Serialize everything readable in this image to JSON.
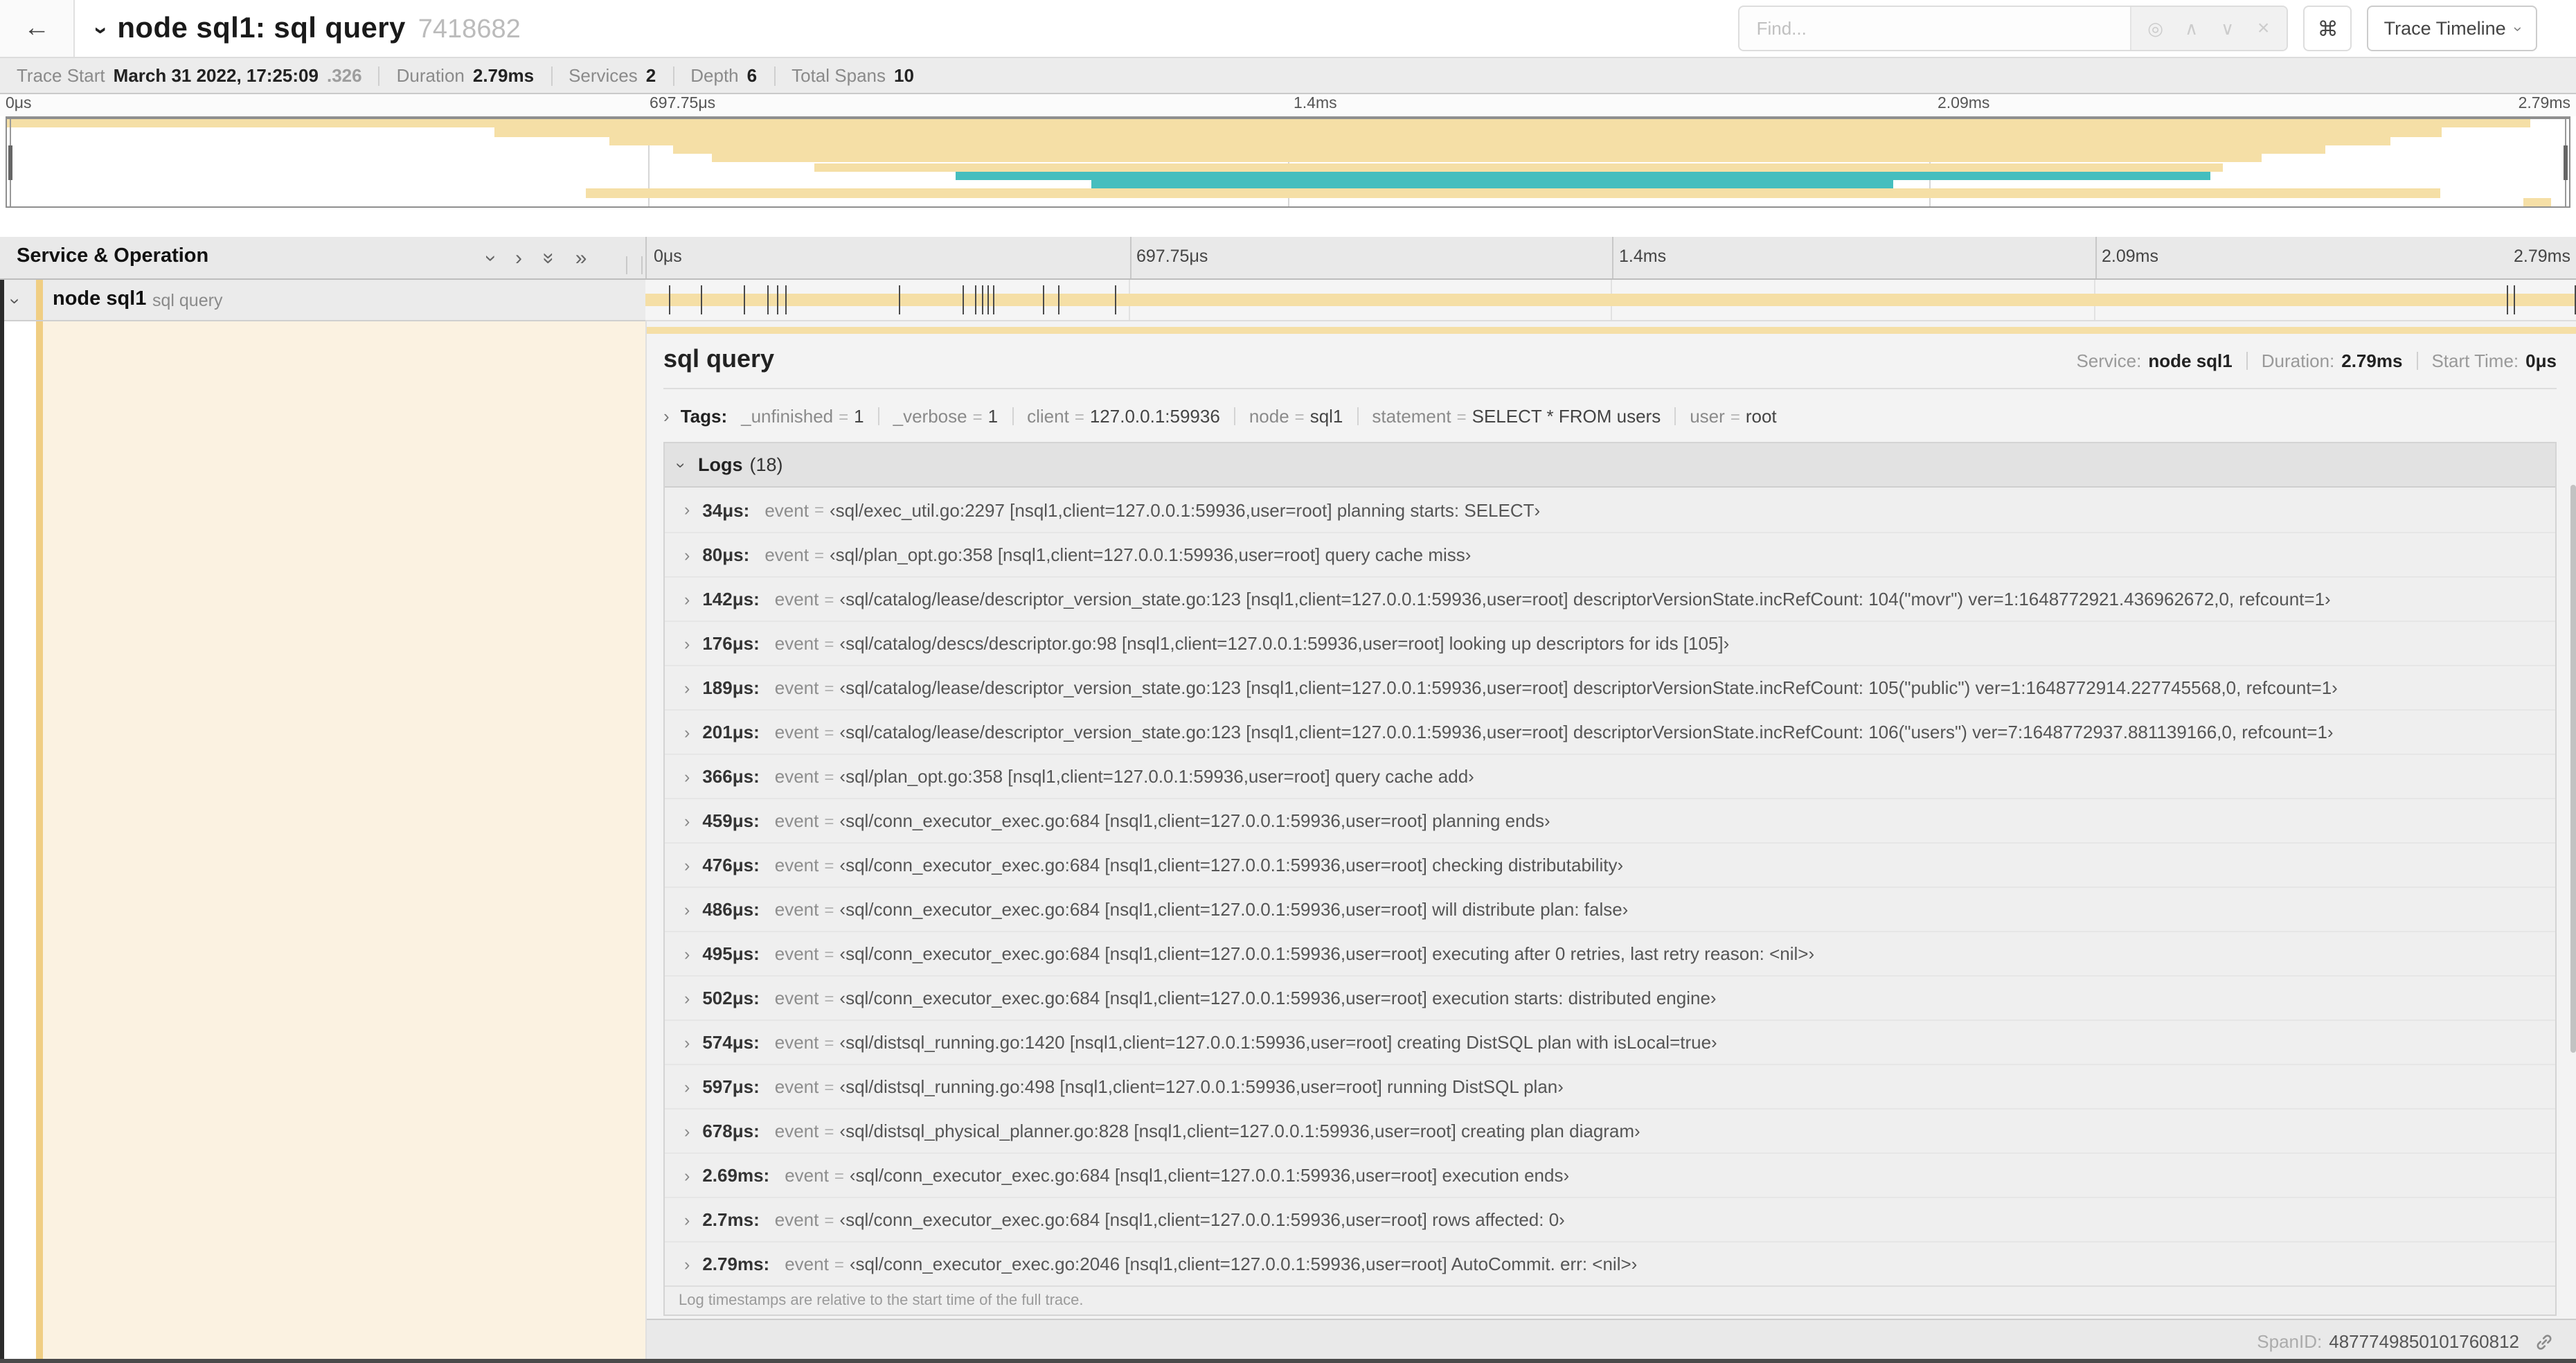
{
  "header": {
    "back_icon": "←",
    "collapse_caret_icon": "›",
    "title": "node sql1: sql query",
    "trace_id": "7418682",
    "find": {
      "placeholder": "Find...",
      "locate_icon": "◎",
      "prev_icon": "∧",
      "next_icon": "∨",
      "clear_icon": "×"
    },
    "shortcut_button_label": "⌘",
    "view_selector_label": "Trace Timeline"
  },
  "trace_bar": {
    "items": [
      {
        "label": "Trace Start",
        "value": "March 31 2022, 17:25:09",
        "muted_suffix": ".326"
      },
      {
        "label": "Duration",
        "value": "2.79ms"
      },
      {
        "label": "Services",
        "value": "2"
      },
      {
        "label": "Depth",
        "value": "6"
      },
      {
        "label": "Total Spans",
        "value": "10"
      }
    ]
  },
  "timeline": {
    "ticks": [
      "0μs",
      "697.75μs",
      "1.4ms",
      "2.09ms",
      "2.79ms"
    ],
    "service_operation_label": "Service & Operation",
    "minimap_spans": [
      {
        "start": 0,
        "end": 98.5,
        "color": "#F5DFA6"
      },
      {
        "start": 19,
        "end": 95,
        "color": "#F5DFA6"
      },
      {
        "start": 23.5,
        "end": 93,
        "color": "#F5DFA6"
      },
      {
        "start": 26,
        "end": 90.5,
        "color": "#F5DFA6"
      },
      {
        "start": 27.5,
        "end": 88,
        "color": "#F5DFA6"
      },
      {
        "start": 31.5,
        "end": 86.5,
        "color": "#F5DFA6"
      },
      {
        "start": 37,
        "end": 86,
        "color": "#45BEBE"
      },
      {
        "start": 42.3,
        "end": 73.6,
        "color": "#45BEBE"
      },
      {
        "start": 22.6,
        "end": 95,
        "color": "#F5DFA6"
      },
      {
        "start": 98.2,
        "end": 99.3,
        "color": "#F5DFA6"
      }
    ],
    "row": {
      "service": "node sql1",
      "operation": "sql query",
      "log_marker_fractions": [
        0.0122,
        0.0287,
        0.0509,
        0.0631,
        0.0678,
        0.0721,
        0.1312,
        0.1645,
        0.1706,
        0.1742,
        0.1774,
        0.18,
        0.2057,
        0.214,
        0.243,
        0.964,
        0.968,
        0.999
      ]
    }
  },
  "detail": {
    "title": "sql query",
    "overview": [
      {
        "label": "Service:",
        "value": "node sql1"
      },
      {
        "label": "Duration:",
        "value": "2.79ms"
      },
      {
        "label": "Start Time:",
        "value": "0μs"
      }
    ],
    "tags": {
      "label": "Tags:",
      "items": [
        {
          "key": "_unfinished",
          "value": "1"
        },
        {
          "key": "_verbose",
          "value": "1"
        },
        {
          "key": "client",
          "value": "127.0.0.1:59936"
        },
        {
          "key": "node",
          "value": "sql1"
        },
        {
          "key": "statement",
          "value": "SELECT * FROM users"
        },
        {
          "key": "user",
          "value": "root"
        }
      ]
    },
    "logs": {
      "label": "Logs",
      "count": "(18)",
      "field_name": "event",
      "entries": [
        {
          "time": "34μs:",
          "value": "‹sql/exec_util.go:2297 [nsql1,client=127.0.0.1:59936,user=root] planning starts: SELECT›"
        },
        {
          "time": "80μs:",
          "value": "‹sql/plan_opt.go:358 [nsql1,client=127.0.0.1:59936,user=root] query cache miss›"
        },
        {
          "time": "142μs:",
          "value": "‹sql/catalog/lease/descriptor_version_state.go:123 [nsql1,client=127.0.0.1:59936,user=root] descriptorVersionState.incRefCount: 104(\"movr\") ver=1:1648772921.436962672,0, refcount=1›"
        },
        {
          "time": "176μs:",
          "value": "‹sql/catalog/descs/descriptor.go:98 [nsql1,client=127.0.0.1:59936,user=root] looking up descriptors for ids [105]›"
        },
        {
          "time": "189μs:",
          "value": "‹sql/catalog/lease/descriptor_version_state.go:123 [nsql1,client=127.0.0.1:59936,user=root] descriptorVersionState.incRefCount: 105(\"public\") ver=1:1648772914.227745568,0, refcount=1›"
        },
        {
          "time": "201μs:",
          "value": "‹sql/catalog/lease/descriptor_version_state.go:123 [nsql1,client=127.0.0.1:59936,user=root] descriptorVersionState.incRefCount: 106(\"users\") ver=7:1648772937.881139166,0, refcount=1›"
        },
        {
          "time": "366μs:",
          "value": "‹sql/plan_opt.go:358 [nsql1,client=127.0.0.1:59936,user=root] query cache add›"
        },
        {
          "time": "459μs:",
          "value": "‹sql/conn_executor_exec.go:684 [nsql1,client=127.0.0.1:59936,user=root] planning ends›"
        },
        {
          "time": "476μs:",
          "value": "‹sql/conn_executor_exec.go:684 [nsql1,client=127.0.0.1:59936,user=root] checking distributability›"
        },
        {
          "time": "486μs:",
          "value": "‹sql/conn_executor_exec.go:684 [nsql1,client=127.0.0.1:59936,user=root] will distribute plan: false›"
        },
        {
          "time": "495μs:",
          "value": "‹sql/conn_executor_exec.go:684 [nsql1,client=127.0.0.1:59936,user=root] executing after 0 retries, last retry reason: <nil>›"
        },
        {
          "time": "502μs:",
          "value": "‹sql/conn_executor_exec.go:684 [nsql1,client=127.0.0.1:59936,user=root] execution starts: distributed engine›"
        },
        {
          "time": "574μs:",
          "value": "‹sql/distsql_running.go:1420 [nsql1,client=127.0.0.1:59936,user=root] creating DistSQL plan with isLocal=true›"
        },
        {
          "time": "597μs:",
          "value": "‹sql/distsql_running.go:498 [nsql1,client=127.0.0.1:59936,user=root] running DistSQL plan›"
        },
        {
          "time": "678μs:",
          "value": "‹sql/distsql_physical_planner.go:828 [nsql1,client=127.0.0.1:59936,user=root] creating plan diagram›"
        },
        {
          "time": "2.69ms:",
          "value": "‹sql/conn_executor_exec.go:684 [nsql1,client=127.0.0.1:59936,user=root] execution ends›"
        },
        {
          "time": "2.7ms:",
          "value": "‹sql/conn_executor_exec.go:684 [nsql1,client=127.0.0.1:59936,user=root] rows affected: 0›"
        },
        {
          "time": "2.79ms:",
          "value": "‹sql/conn_executor_exec.go:2046 [nsql1,client=127.0.0.1:59936,user=root] AutoCommit. err: <nil>›"
        }
      ],
      "note": "Log timestamps are relative to the start time of the full trace."
    },
    "footer": {
      "label": "SpanID:",
      "value": "4877749850101760812"
    }
  },
  "colors": {
    "span_tan": "#F5DFA6",
    "span_teal": "#45BEBE",
    "accent_stripe": "#F0CE83",
    "cream": "#FBF2E1"
  }
}
